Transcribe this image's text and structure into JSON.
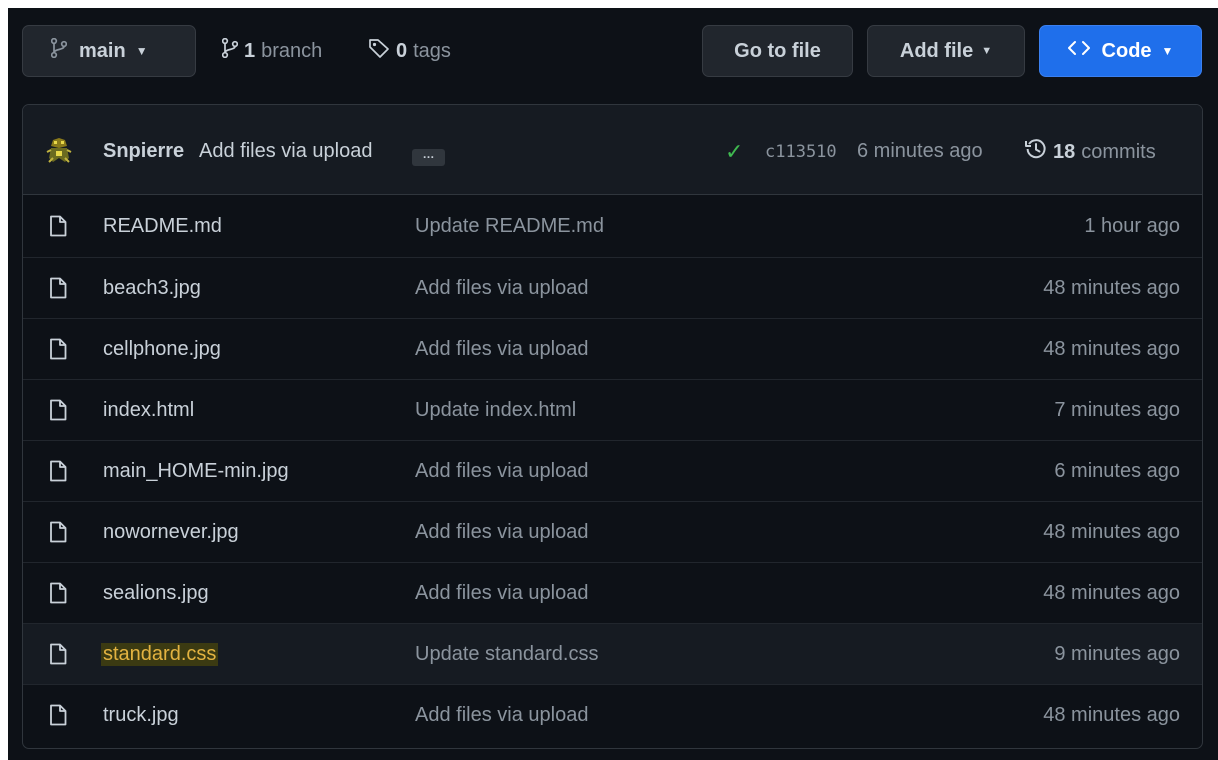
{
  "toolbar": {
    "branch_button": {
      "label": "main",
      "icon": "git-branch-icon"
    },
    "branches": {
      "count": "1",
      "label": "branch",
      "icon": "git-branch-icon"
    },
    "tags": {
      "count": "0",
      "label": "tags",
      "icon": "tag-icon"
    },
    "go_to_file": "Go to file",
    "add_file": "Add file",
    "code": {
      "label": "Code",
      "icon": "code-icon"
    }
  },
  "latest_commit": {
    "author": "Snpierre",
    "message": "Add files via upload",
    "ellipsis": "…",
    "status_icon": "check-icon",
    "sha": "c113510",
    "time": "6 minutes ago",
    "commits_count": "18",
    "commits_label": "commits",
    "history_icon": "history-icon"
  },
  "files": [
    {
      "name": "README.md",
      "message": "Update README.md",
      "time": "1 hour ago"
    },
    {
      "name": "beach3.jpg",
      "message": "Add files via upload",
      "time": "48 minutes ago"
    },
    {
      "name": "cellphone.jpg",
      "message": "Add files via upload",
      "time": "48 minutes ago"
    },
    {
      "name": "index.html",
      "message": "Update index.html",
      "time": "7 minutes ago"
    },
    {
      "name": "main_HOME-min.jpg",
      "message": "Add files via upload",
      "time": "6 minutes ago"
    },
    {
      "name": "nowornever.jpg",
      "message": "Add files via upload",
      "time": "48 minutes ago"
    },
    {
      "name": "sealions.jpg",
      "message": "Add files via upload",
      "time": "48 minutes ago"
    },
    {
      "name": "standard.css",
      "message": "Update standard.css",
      "time": "9 minutes ago"
    },
    {
      "name": "truck.jpg",
      "message": "Add files via upload",
      "time": "48 minutes ago"
    }
  ],
  "colors": {
    "background": "#0d1117",
    "header_bg": "#161b22",
    "border": "#30363d",
    "code_button": "#1f6feb",
    "success": "#3fb950",
    "highlight": "#e3b341"
  }
}
